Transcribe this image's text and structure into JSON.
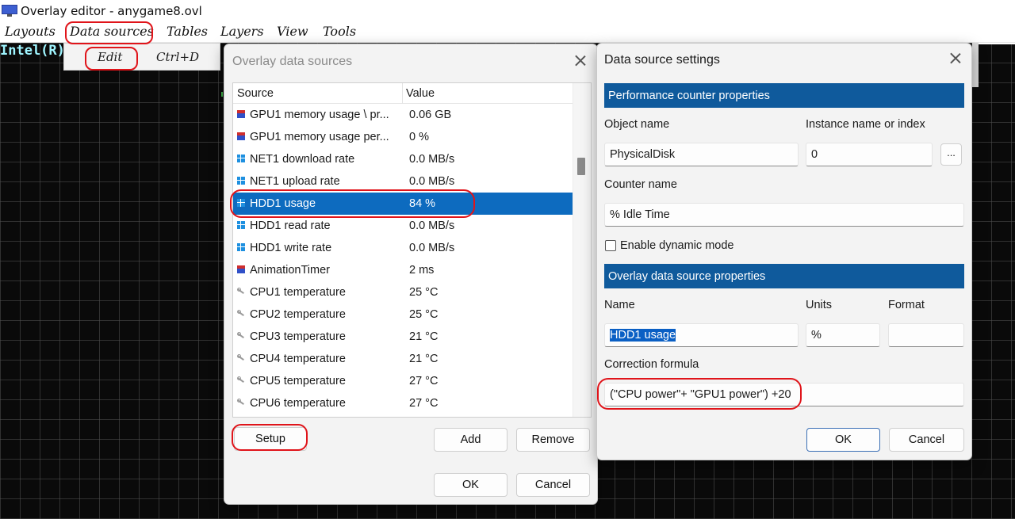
{
  "window": {
    "title": "Overlay editor - anygame8.ovl"
  },
  "menubar": {
    "items": [
      "Layouts",
      "Data sources",
      "Tables",
      "Layers",
      "View",
      "Tools"
    ]
  },
  "dropdown": {
    "item_label": "Edit",
    "item_shortcut": "Ctrl+D"
  },
  "canvas": {
    "overlay_text": "Intel(R)"
  },
  "data_sources_dialog": {
    "title": "Overlay data sources",
    "columns": [
      "Source",
      "Value"
    ],
    "rows": [
      {
        "icon": "gpu-icon",
        "source": "GPU1 memory usage \\ pr...",
        "value": "0.06 GB"
      },
      {
        "icon": "gpu-icon",
        "source": "GPU1 memory usage per...",
        "value": "0 %"
      },
      {
        "icon": "windows-icon",
        "source": "NET1 download rate",
        "value": "0.0 MB/s"
      },
      {
        "icon": "windows-icon",
        "source": "NET1 upload rate",
        "value": "0.0 MB/s"
      },
      {
        "icon": "windows-icon",
        "source": "HDD1 usage",
        "value": "84 %",
        "selected": true
      },
      {
        "icon": "windows-icon",
        "source": "HDD1 read rate",
        "value": "0.0 MB/s"
      },
      {
        "icon": "windows-icon",
        "source": "HDD1 write rate",
        "value": "0.0 MB/s"
      },
      {
        "icon": "gpu-icon",
        "source": "AnimationTimer",
        "value": "2 ms"
      },
      {
        "icon": "cpu-sensor-icon",
        "source": "CPU1 temperature",
        "value": "25 °C"
      },
      {
        "icon": "cpu-sensor-icon",
        "source": "CPU2 temperature",
        "value": "25 °C"
      },
      {
        "icon": "cpu-sensor-icon",
        "source": "CPU3 temperature",
        "value": "21 °C"
      },
      {
        "icon": "cpu-sensor-icon",
        "source": "CPU4 temperature",
        "value": "21 °C"
      },
      {
        "icon": "cpu-sensor-icon",
        "source": "CPU5 temperature",
        "value": "27 °C"
      },
      {
        "icon": "cpu-sensor-icon",
        "source": "CPU6 temperature",
        "value": "27 °C"
      }
    ],
    "buttons": {
      "setup": "Setup",
      "add": "Add",
      "remove": "Remove",
      "ok": "OK",
      "cancel": "Cancel"
    }
  },
  "settings_dialog": {
    "title": "Data source settings",
    "perf_section": "Performance counter properties",
    "object_name_label": "Object name",
    "object_name_value": "PhysicalDisk",
    "instance_label": "Instance name or index",
    "instance_value": "0",
    "more_button": "...",
    "counter_label": "Counter name",
    "counter_value": "% Idle Time",
    "dynamic_mode_label": "Enable dynamic mode",
    "dynamic_mode_checked": false,
    "overlay_section": "Overlay data source properties",
    "name_label": "Name",
    "name_value": "HDD1 usage",
    "units_label": "Units",
    "units_value": "%",
    "format_label": "Format",
    "format_value": "",
    "formula_label": "Correction formula",
    "formula_value": "(\"CPU power\"+ \"GPU1 power\") +20",
    "buttons": {
      "ok": "OK",
      "cancel": "Cancel"
    }
  },
  "colors": {
    "selection": "#0d6bbf",
    "section_header": "#0f5a9c",
    "annotation": "#e0141a",
    "overlay_text": "#9ff5ff"
  }
}
